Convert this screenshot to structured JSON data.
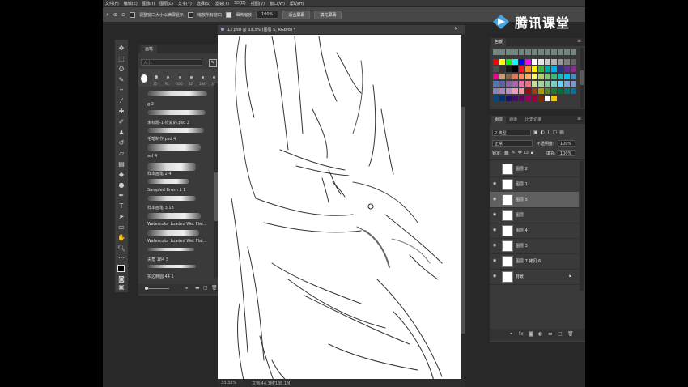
{
  "menu": [
    "文件(F)",
    "编辑(E)",
    "图像(I)",
    "图层(L)",
    "文字(Y)",
    "选择(S)",
    "滤镜(T)",
    "3D(D)",
    "视图(V)",
    "窗口(W)",
    "帮助(H)"
  ],
  "options": {
    "check1_label": "调整窗口大小以满屏显示",
    "check2_label": "缩放所有窗口",
    "check3_label": "细微缩放",
    "zoom_value": "100%",
    "fit_screen": "适合屏幕",
    "fill_screen": "填充屏幕"
  },
  "brushes": {
    "tab": "画笔",
    "search_placeholder": "大小:",
    "sizes": [
      "15",
      "91",
      "100",
      "12",
      "184",
      "10"
    ],
    "items": [
      "g 2",
      "未标题-1-恢复的.psd 2",
      "毛笔制作.psd 4",
      "asf 4",
      "样本画笔 2 4",
      "Sampled Brush 1 1",
      "样本画笔 3 18",
      "Watercolor Loaded Wet Flat...",
      "Watercolor Loaded Wet Flat...",
      "尖角 184 3",
      "实边椭圆 44 1"
    ]
  },
  "document": {
    "tab_title": "12.psd @ 33.3% (图层 5, RGB/8) *",
    "status_zoom": "33.33%",
    "status_doc": "文档:44.3M/138.1M"
  },
  "swatches": {
    "tab": "色板",
    "colors": [
      "#ff0000",
      "#ffff00",
      "#00ff00",
      "#00ffff",
      "#0000ff",
      "#ff00ff",
      "#ffffff",
      "#e6e6e6",
      "#cccccc",
      "#b3b3b3",
      "#999999",
      "#808080",
      "#666666",
      "#4d4d4d",
      "#333333",
      "#1a1a1a",
      "#000000",
      "#ed1c24",
      "#f7941d",
      "#fff200",
      "#39b54a",
      "#00a99d",
      "#00aeef",
      "#2e3192",
      "#662d91",
      "#92278f",
      "#ec008c",
      "#c69c6d",
      "#8c6239",
      "#f26c4f",
      "#f68e56",
      "#fbaf5d",
      "#fff568",
      "#acd373",
      "#7cc576",
      "#3bb878",
      "#1abbb4",
      "#00bff3",
      "#448ccb",
      "#5674b9",
      "#605ca8",
      "#8560a8",
      "#a864a8",
      "#f06eaa",
      "#f26d7d",
      "#c4df9b",
      "#a2d39c",
      "#82ca9d",
      "#7accc8",
      "#6dcff6",
      "#7da7d9",
      "#8393ca",
      "#8781bd",
      "#a187be",
      "#bd8cbf",
      "#f49ac1",
      "#f5989d",
      "#9e0b0f",
      "#a0410d",
      "#aba000",
      "#598527",
      "#1a7b30",
      "#007236",
      "#00746b",
      "#0076a3",
      "#004a80",
      "#003471",
      "#1b1464",
      "#440e62",
      "#630460",
      "#9e005d",
      "#9e0039",
      "#7b2e00",
      "#ffffff",
      "#f1c40f"
    ],
    "top_row": [
      "#6d8a80",
      "#6d8a80",
      "#6d8a80",
      "#6d8a80",
      "#6d8a80",
      "#6d8a80",
      "#6d8a80",
      "#6d8a80",
      "#6d8a80",
      "#6d8a80",
      "#6d8a80",
      "#6d8a80",
      "#6d8a80"
    ]
  },
  "layers": {
    "tabs": [
      "图层",
      "通道",
      "历史记录"
    ],
    "kind_label": "P 类型",
    "blend_mode": "正常",
    "opacity_label": "不透明度:",
    "opacity_value": "100%",
    "lock_label": "锁定:",
    "fill_label": "填充:",
    "fill_value": "100%",
    "items": [
      {
        "name": "图层 2",
        "visible": false,
        "selected": false
      },
      {
        "name": "图层 1",
        "visible": true,
        "selected": false
      },
      {
        "name": "图层 5",
        "visible": true,
        "selected": true
      },
      {
        "name": "图层",
        "visible": true,
        "selected": false
      },
      {
        "name": "图层 4",
        "visible": true,
        "selected": false
      },
      {
        "name": "图层 3",
        "visible": true,
        "selected": false
      },
      {
        "name": "图层 7 拷贝 6",
        "visible": true,
        "selected": false
      },
      {
        "name": "背景",
        "visible": true,
        "selected": false
      }
    ]
  },
  "watermark": "腾讯课堂"
}
